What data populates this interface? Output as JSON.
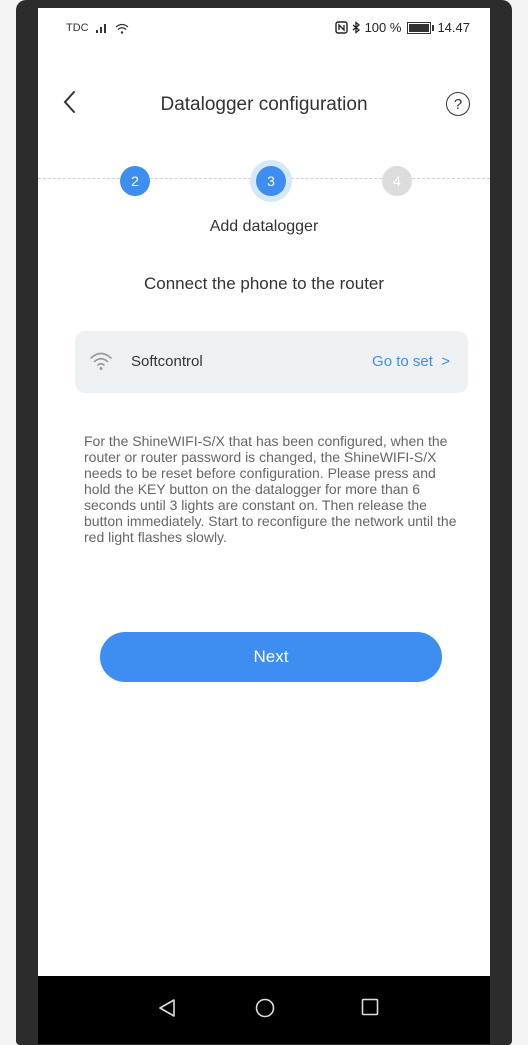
{
  "status_bar": {
    "carrier": "TDC",
    "battery_text": "100 %",
    "battery_level": 1.0,
    "time": "14.47"
  },
  "header": {
    "title": "Datalogger configuration",
    "back_icon": "chevron-left-icon",
    "help_icon": "help-circle-icon",
    "help_symbol": "?"
  },
  "stepper": {
    "steps": [
      {
        "label": "2",
        "state": "done"
      },
      {
        "label": "3",
        "state": "current"
      },
      {
        "label": "4",
        "state": "pending"
      }
    ],
    "caption": "Add datalogger"
  },
  "main": {
    "instruction": "Connect the phone to the router",
    "wifi": {
      "icon": "wifi-icon",
      "network_name": "Softcontrol",
      "action_label": "Go to set  >"
    },
    "notice": "For the ShineWIFI-S/X that has been configured, when the router or router password is changed, the ShineWIFI-S/X needs to be reset before configuration. Please press and hold the KEY button on the datalogger for more than 6 seconds until 3 lights are constant on. Then release the button immediately. Start to reconfigure the network until the red light flashes slowly.",
    "next_label": "Next"
  },
  "nav": {
    "back_icon": "triangle-back-icon",
    "home_icon": "circle-home-icon",
    "recents_icon": "square-recents-icon"
  },
  "colors": {
    "accent": "#3d8ef0",
    "card_bg": "#eef1f4"
  }
}
